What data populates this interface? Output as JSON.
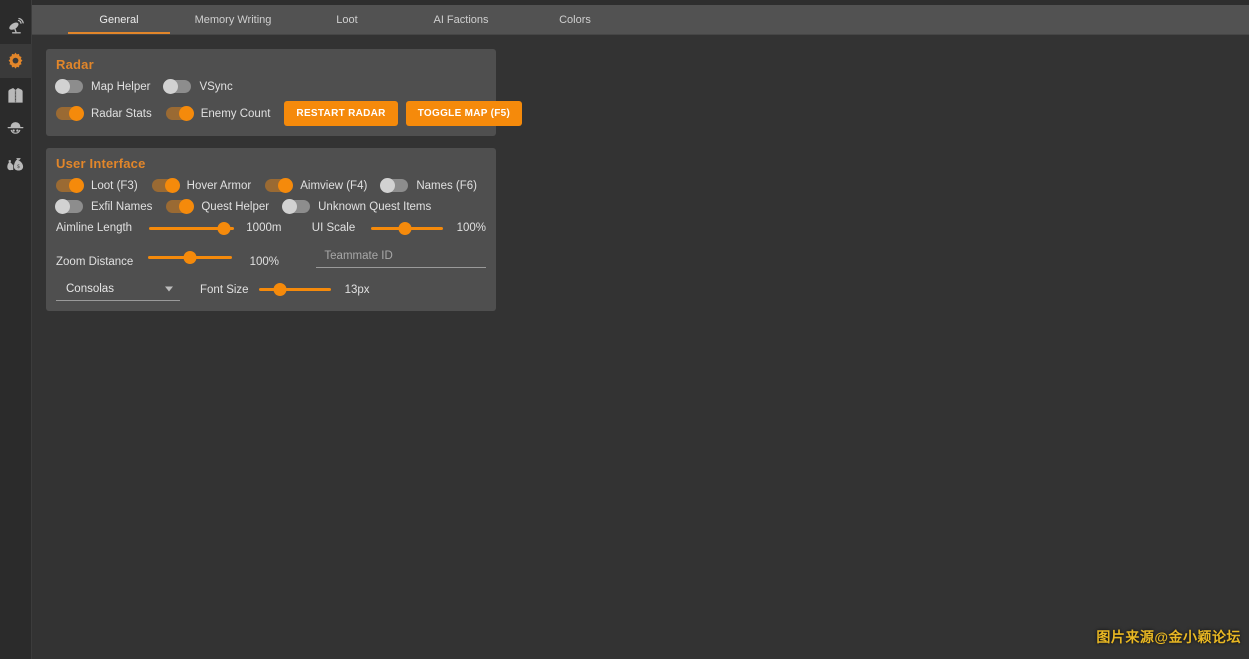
{
  "sidebar": {
    "items": [
      {
        "name": "radar-dish-icon",
        "label": "Radar",
        "active": false
      },
      {
        "name": "gear-icon",
        "label": "Settings",
        "active": true
      },
      {
        "name": "jacket-icon",
        "label": "Gear",
        "active": false
      },
      {
        "name": "scav-hat-icon",
        "label": "Players",
        "active": false
      },
      {
        "name": "money-bags-icon",
        "label": "Loot Value",
        "active": false
      }
    ]
  },
  "tabs": [
    {
      "label": "General",
      "active": true
    },
    {
      "label": "Memory Writing",
      "active": false
    },
    {
      "label": "Loot",
      "active": false
    },
    {
      "label": "AI Factions",
      "active": false
    },
    {
      "label": "Colors",
      "active": false
    }
  ],
  "radar_card": {
    "title": "Radar",
    "toggles": [
      {
        "label": "Map Helper",
        "on": false
      },
      {
        "label": "VSync",
        "on": false
      },
      {
        "label": "Radar Stats",
        "on": true
      },
      {
        "label": "Enemy Count",
        "on": true
      }
    ],
    "buttons": [
      {
        "label": "RESTART RADAR"
      },
      {
        "label": "TOGGLE MAP (F5)"
      }
    ]
  },
  "ui_card": {
    "title": "User Interface",
    "toggles_row1": [
      {
        "label": "Loot (F3)",
        "on": true
      },
      {
        "label": "Hover Armor",
        "on": true
      },
      {
        "label": "Aimview (F4)",
        "on": true
      },
      {
        "label": "Names (F6)",
        "on": false
      }
    ],
    "toggles_row2": [
      {
        "label": "Exfil Names",
        "on": false
      },
      {
        "label": "Quest Helper",
        "on": true
      },
      {
        "label": "Unknown Quest Items",
        "on": false
      }
    ],
    "sliders": {
      "aimline_length": {
        "label": "Aimline Length",
        "value": "1000m",
        "percent": 88
      },
      "ui_scale": {
        "label": "UI Scale",
        "value": "100%",
        "percent": 48
      },
      "zoom_distance": {
        "label": "Zoom Distance",
        "value": "100%",
        "percent": 50
      },
      "font_size": {
        "label": "Font Size",
        "value": "13px",
        "percent": 30
      }
    },
    "teammate_id": {
      "placeholder": "Teammate ID",
      "value": ""
    },
    "font_select": {
      "value": "Consolas"
    }
  },
  "watermark": {
    "text": "图片来源@金小颖论坛"
  },
  "colors": {
    "accent": "#f58a0b",
    "title_accent": "#e2862a",
    "background": "#333333",
    "card": "#4f4f4f",
    "sidebar": "#2b2b2b",
    "tabbar": "#525252",
    "watermark": "#e8b723"
  }
}
